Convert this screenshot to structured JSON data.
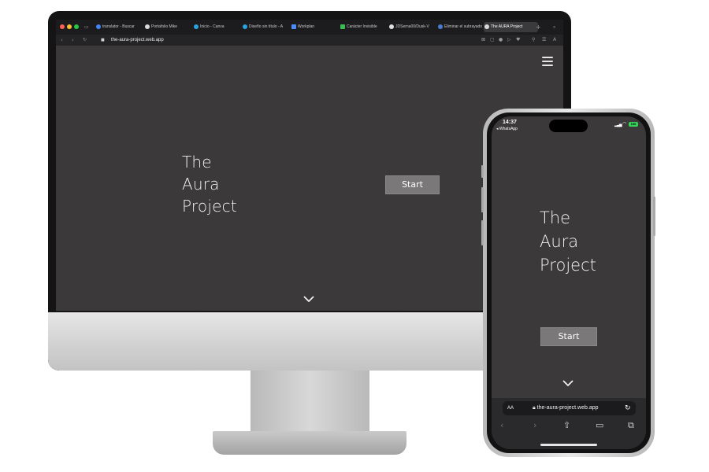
{
  "desktop": {
    "tabs": [
      {
        "label": "translator - Buscar",
        "color": "#4285f4"
      },
      {
        "label": "Portafolio Mike",
        "color": "#d9d9d9"
      },
      {
        "label": "Inicio - Canva",
        "color": "#2aa1e0"
      },
      {
        "label": "Diseño sin título - A",
        "color": "#2aa1e0"
      },
      {
        "label": "Workplan",
        "color": "#4c8bf5"
      },
      {
        "label": "Carácter Invisible",
        "color": "#3cba54"
      },
      {
        "label": "JDSerna00/Dusk-V",
        "color": "#e0e0e0"
      },
      {
        "label": "Eliminar el subrayado",
        "color": "#4a7bd0"
      },
      {
        "label": "The AURA Project",
        "color": "#d9d9d9",
        "active": true
      }
    ],
    "url": "the-aura-project.web.app",
    "site": {
      "title_lines": [
        "The",
        "Aura",
        "Project"
      ],
      "start_label": "Start"
    }
  },
  "mobile": {
    "time": "14:37",
    "back_app": "◂ WhatsApp",
    "battery": "100",
    "title_lines": [
      "The",
      "Aura",
      "Project"
    ],
    "start_label": "Start",
    "url_aa": "AA",
    "url": "the-aura-project.web.app"
  },
  "colors": {
    "site_bg": "#3b3939",
    "button_bg": "#7a7878",
    "text": "#f2f2f2"
  }
}
